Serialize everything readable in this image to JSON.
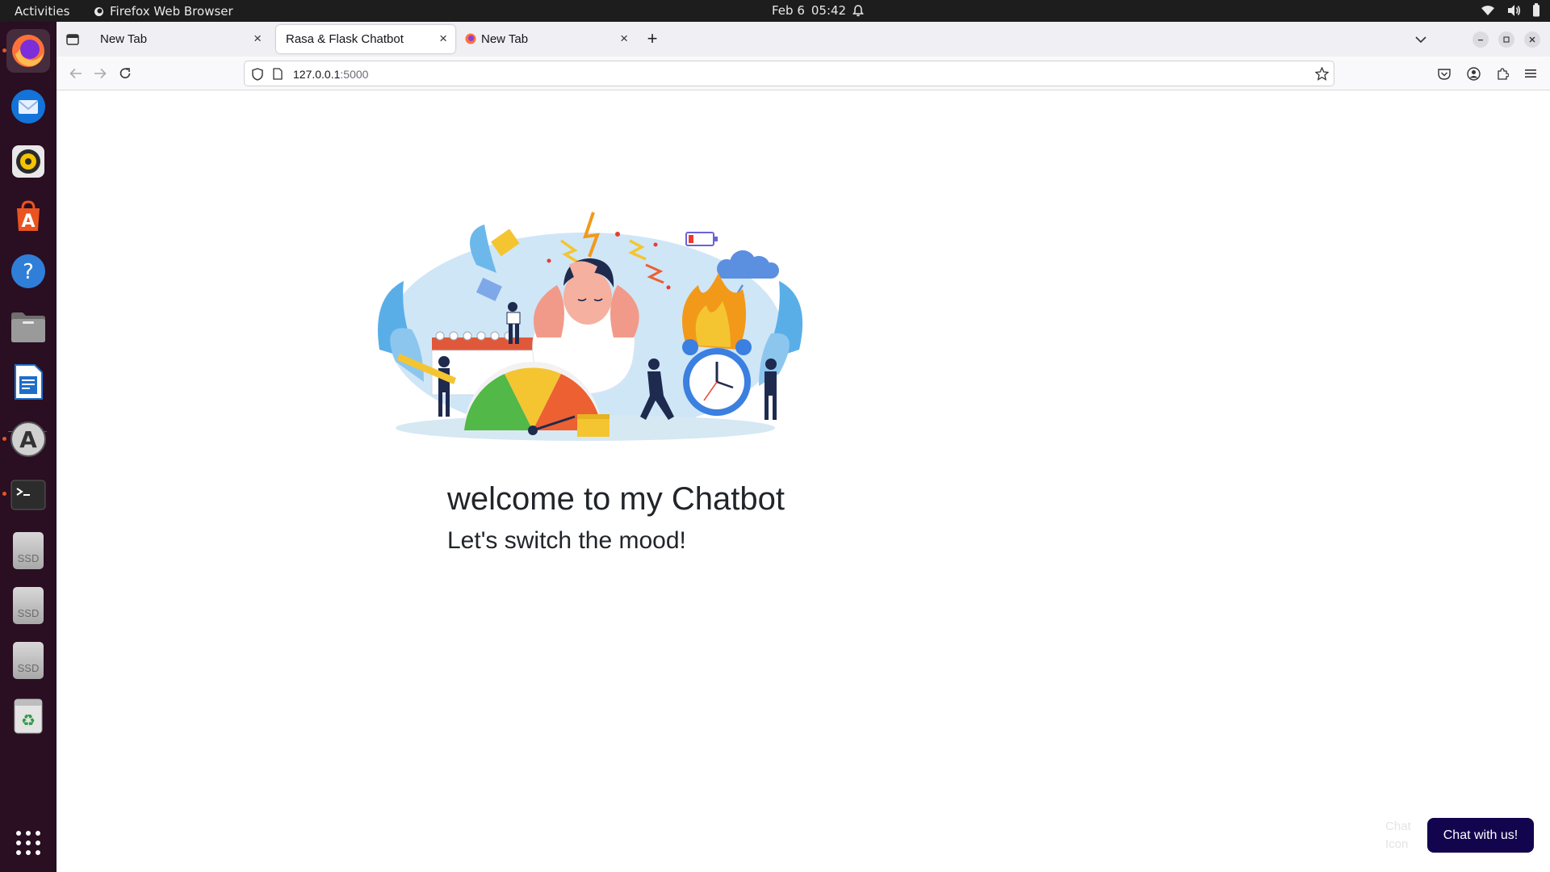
{
  "topbar": {
    "activities": "Activities",
    "app_name": "Firefox Web Browser",
    "date": "Feb 6",
    "time": "05:42"
  },
  "dock": {
    "items": [
      "firefox-icon",
      "thunderbird-icon",
      "rhythmbox-icon",
      "app-center-icon",
      "help-icon",
      "files-icon",
      "writer-icon",
      "software-updater-icon",
      "terminal-icon",
      "ssd-drive-icon",
      "ssd-drive-icon",
      "ssd-drive-icon",
      "trash-icon",
      "show-apps-icon"
    ],
    "ssd_label": "SSD"
  },
  "browser": {
    "tabs": [
      {
        "title": "New Tab",
        "selected": false
      },
      {
        "title": "Rasa & Flask Chatbot",
        "selected": true
      },
      {
        "title": "New Tab",
        "selected": false
      }
    ],
    "close_glyph": "×",
    "new_tab_glyph": "+",
    "url_host": "127.0.0.1",
    "url_port": ":5000"
  },
  "page": {
    "heading": "welcome to my Chatbot",
    "subheading": "Let's switch the mood!",
    "chat_icon_alt": "Chat Icon",
    "chat_button": "Chat with us!"
  },
  "colors": {
    "accent": "#e95420",
    "chat_button_bg": "#12044d",
    "dock_bg": "#2a0e22"
  }
}
